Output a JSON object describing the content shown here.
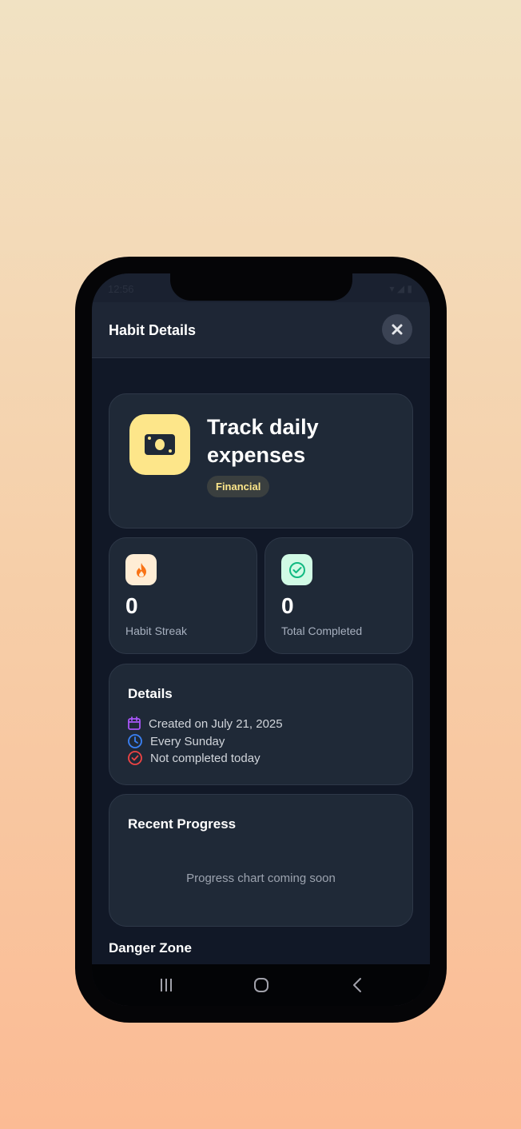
{
  "status_bar": {
    "time": "12:56",
    "indicators": "Wi-Fi, signal, battery"
  },
  "header": {
    "title": "Habit Details",
    "close_icon": "close-icon"
  },
  "habit": {
    "title": "Track daily expenses",
    "category": "Financial",
    "icon": "money-icon",
    "icon_bg": "#fde68a"
  },
  "stats": [
    {
      "icon": "fire-icon",
      "value": "0",
      "label": "Habit Streak",
      "color": "#f97316"
    },
    {
      "icon": "check-circle-icon",
      "value": "0",
      "label": "Total Completed",
      "color": "#10b981"
    }
  ],
  "details": {
    "title": "Details",
    "rows": [
      {
        "icon": "calendar-icon",
        "text": "Created on July 21, 2025",
        "color": "#a855f7"
      },
      {
        "icon": "clock-icon",
        "text": "Every Sunday",
        "color": "#3b82f6"
      },
      {
        "icon": "x-circle-icon",
        "text": "Not completed today",
        "color": "#ef4444"
      }
    ]
  },
  "progress": {
    "title": "Recent Progress",
    "message": "Progress chart coming soon"
  },
  "danger": {
    "title": "Danger Zone"
  },
  "navbar": {
    "recent_icon": "recent-apps-icon",
    "home_icon": "home-icon",
    "back_icon": "back-icon"
  }
}
